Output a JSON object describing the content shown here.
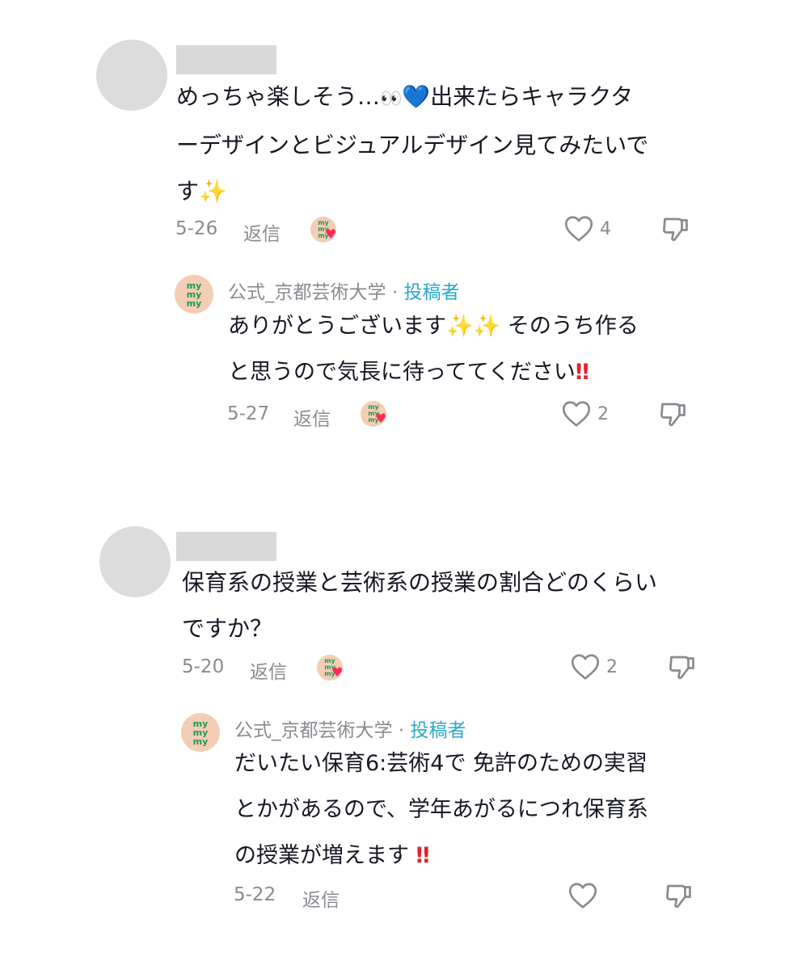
{
  "comments": [
    {
      "lines": [
        [
          "めっちゃ楽しそう…",
          "👀",
          "💙",
          "出来たらキャラクタ"
        ],
        [
          "ーデザインとビジュアルデザイン見てみたいで"
        ],
        [
          "す",
          "✨"
        ]
      ],
      "date": "5-26",
      "reply_label": "返信",
      "likes": "4",
      "reply": {
        "author": "公式_京都芸術大学",
        "separator": "·",
        "badge": "投稿者",
        "lines": [
          [
            "ありがとうございます",
            "✨",
            "✨",
            " そのうち作る"
          ],
          [
            "と思うので気長に待っててください",
            "‼"
          ]
        ],
        "date": "5-27",
        "reply_label": "返信",
        "likes": "2"
      }
    },
    {
      "lines": [
        [
          "保育系の授業と芸術系の授業の割合どのくらい"
        ],
        [
          "ですか？"
        ]
      ],
      "date": "5-20",
      "reply_label": "返信",
      "likes": "2",
      "reply": {
        "author": "公式_京都芸術大学",
        "separator": "·",
        "badge": "投稿者",
        "lines": [
          [
            "だいたい保育6:芸術4で 免許のための実習"
          ],
          [
            "とかがあるので、学年あがるにつれ保育系"
          ],
          [
            "の授業が増えます ",
            "‼"
          ]
        ],
        "date": "5-22",
        "reply_label": "返信",
        "likes": ""
      }
    }
  ],
  "mymy_logo": [
    "my",
    "my",
    "my"
  ],
  "colors": {
    "author_badge": "#2aa7c9",
    "meta_gray": "#8a8b91",
    "logo_bg": "#f4cdb5",
    "logo_text": "#1f9a52",
    "heart_red": "#ff2b55"
  },
  "icons": {
    "like": "heart-outline-icon",
    "dislike": "thumbs-down-icon",
    "creator_liked": "creator-liked-heart-icon"
  }
}
